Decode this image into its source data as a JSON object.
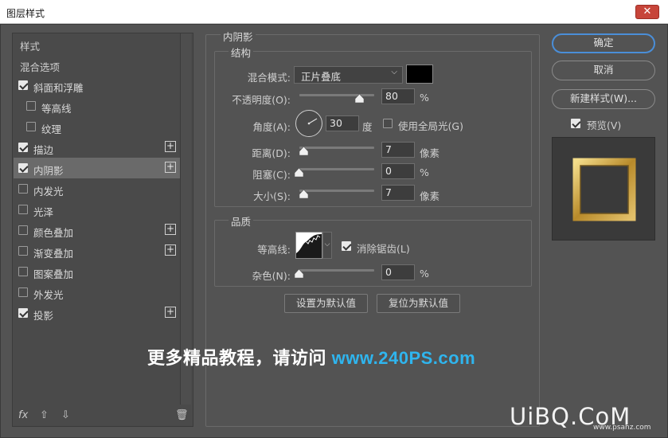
{
  "window": {
    "title": "图层样式",
    "close_glyph": "✕"
  },
  "style_list": {
    "items": [
      {
        "label": "样式",
        "type": "header"
      },
      {
        "label": "混合选项",
        "type": "header"
      },
      {
        "label": "斜面和浮雕",
        "checked": true,
        "plus": false
      },
      {
        "label": "等高线",
        "checked": false,
        "plus": false,
        "indent": true
      },
      {
        "label": "纹理",
        "checked": false,
        "plus": false,
        "indent": true
      },
      {
        "label": "描边",
        "checked": true,
        "plus": true
      },
      {
        "label": "内阴影",
        "checked": true,
        "plus": true,
        "active": true
      },
      {
        "label": "内发光",
        "checked": false,
        "plus": false
      },
      {
        "label": "光泽",
        "checked": false,
        "plus": false
      },
      {
        "label": "颜色叠加",
        "checked": false,
        "plus": true
      },
      {
        "label": "渐变叠加",
        "checked": false,
        "plus": true
      },
      {
        "label": "图案叠加",
        "checked": false,
        "plus": false
      },
      {
        "label": "外发光",
        "checked": false,
        "plus": false
      },
      {
        "label": "投影",
        "checked": true,
        "plus": true
      }
    ],
    "footer": {
      "fx": "fx",
      "up": "⇧",
      "down": "⇩",
      "trash": "🗑"
    }
  },
  "inner_shadow": {
    "title": "内阴影",
    "structure": {
      "title": "结构",
      "blend_mode_label": "混合模式:",
      "blend_mode_value": "正片叠底",
      "shadow_color": "#000000",
      "opacity_label": "不透明度(O):",
      "opacity": "80",
      "opacity_unit": "%",
      "angle_label": "角度(A):",
      "angle": "30",
      "angle_unit": "度",
      "global_light_label": "使用全局光(G)",
      "global_light_checked": false,
      "distance_label": "距离(D):",
      "distance": "7",
      "distance_unit": "像素",
      "choke_label": "阻塞(C):",
      "choke": "0",
      "choke_unit": "%",
      "size_label": "大小(S):",
      "size": "7",
      "size_unit": "像素"
    },
    "quality": {
      "title": "品质",
      "contour_label": "等高线:",
      "anti_alias_label": "消除锯齿(L)",
      "anti_alias_checked": true,
      "noise_label": "杂色(N):",
      "noise": "0",
      "noise_unit": "%"
    },
    "buttons": {
      "make_default": "设置为默认值",
      "reset_default": "复位为默认值"
    }
  },
  "right_panel": {
    "ok": "确定",
    "cancel": "取消",
    "new_style": "新建样式(W)...",
    "preview_label": "预览(V)",
    "preview_checked": true
  },
  "watermark": {
    "text": "更多精品教程，请访问 ",
    "url": "www.240PS.com",
    "logo": "UiBQ.CoM",
    "logo_sub": "www.psahz.com"
  },
  "colors": {
    "accent": "#4a8ed8",
    "panel_bg": "#535353",
    "watermark_url": "#2fb5ee",
    "gold_frame": "#c9a445"
  }
}
